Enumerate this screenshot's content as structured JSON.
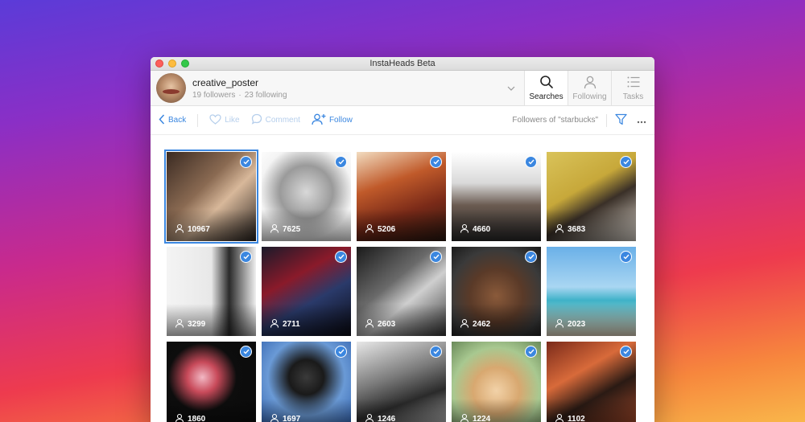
{
  "window": {
    "title": "InstaHeads Beta"
  },
  "account": {
    "username": "creative_poster",
    "followers": "19 followers",
    "separator": "·",
    "following": "23 following"
  },
  "nav": [
    {
      "label": "Searches",
      "icon": "search-icon"
    },
    {
      "label": "Following",
      "icon": "user-icon"
    },
    {
      "label": "Tasks",
      "icon": "list-icon"
    }
  ],
  "toolbar": {
    "back": "Back",
    "like": "Like",
    "comment": "Comment",
    "follow": "Follow",
    "context": "Followers of \"starbucks\""
  },
  "colors": {
    "accent": "#3b87e0",
    "disabled": "#b6cfec"
  },
  "grid": [
    {
      "count": "10967",
      "selected": true
    },
    {
      "count": "7625"
    },
    {
      "count": "5206"
    },
    {
      "count": "4660"
    },
    {
      "count": "3683"
    },
    {
      "count": "3299"
    },
    {
      "count": "2711"
    },
    {
      "count": "2603"
    },
    {
      "count": "2462"
    },
    {
      "count": "2023"
    },
    {
      "count": "1860"
    },
    {
      "count": "1697"
    },
    {
      "count": "1246"
    },
    {
      "count": "1224"
    },
    {
      "count": "1102"
    }
  ]
}
